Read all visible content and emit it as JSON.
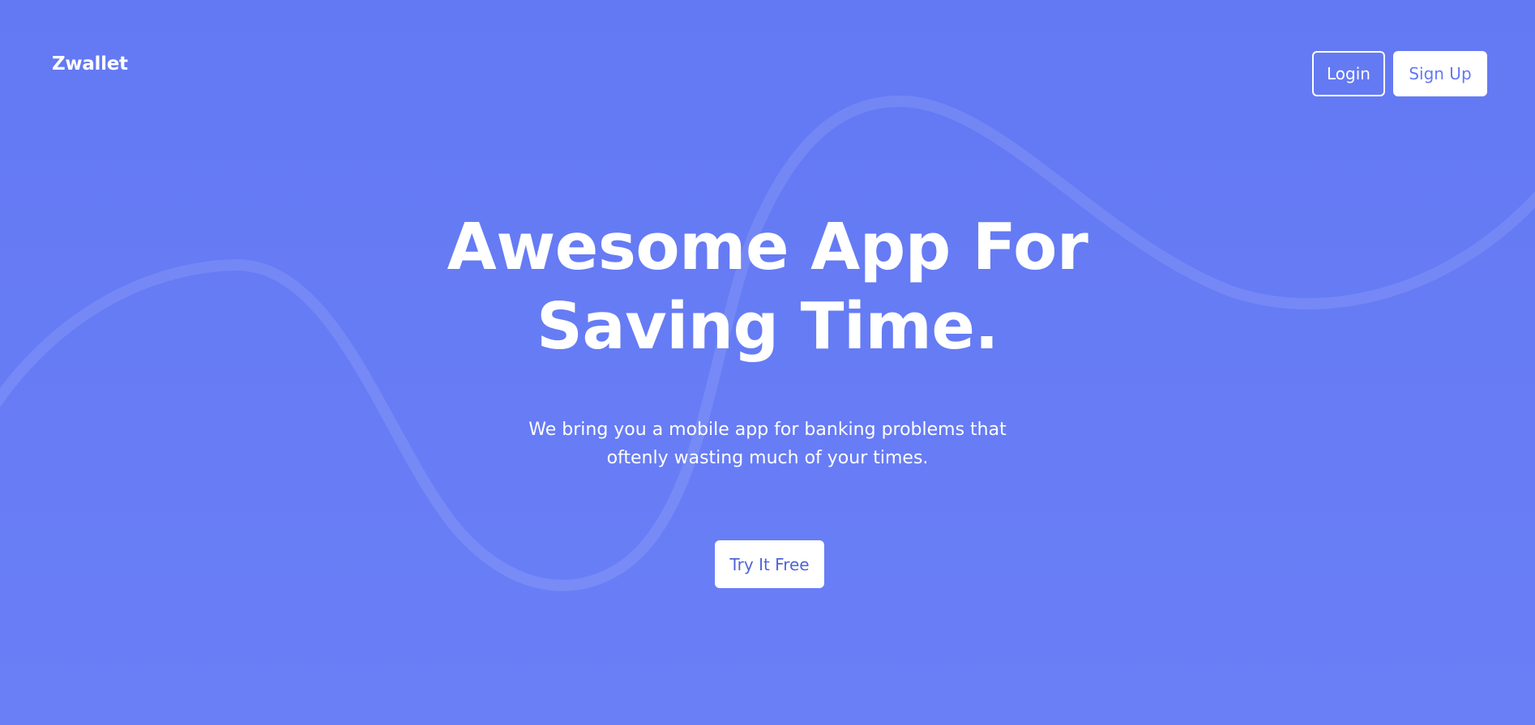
{
  "header": {
    "brand": "Zwallet",
    "login_label": "Login",
    "signup_label": "Sign Up"
  },
  "hero": {
    "title_line1": "Awesome App For",
    "title_line2": "Saving Time.",
    "subtitle_line1": "We bring you a mobile app for banking problems that",
    "subtitle_line2": "oftenly wasting much of your times.",
    "cta_label": "Try It Free"
  },
  "colors": {
    "background": "#6379f3",
    "primary_text": "#ffffff",
    "accent": "#4f64d8"
  }
}
